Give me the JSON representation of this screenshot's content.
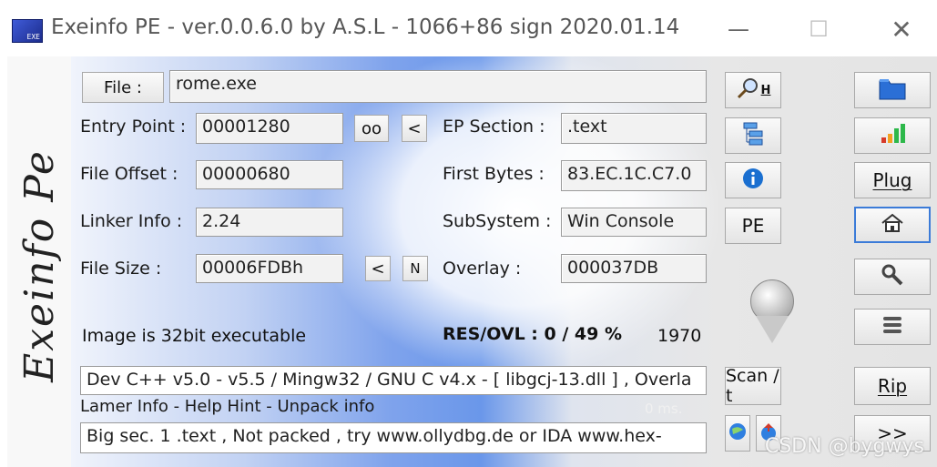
{
  "window": {
    "title": "Exeinfo PE - ver.0.0.6.0  by A.S.L -  1066+86 sign  2020.01.14",
    "app_icon_text": "EXE",
    "minimize": "—",
    "maximize": "☐",
    "close": "✕"
  },
  "brand": "Exeinfo Pe",
  "file": {
    "button_label": "File :",
    "value": "rome.exe"
  },
  "fields": {
    "entry_point_label": "Entry Point :",
    "entry_point_value": "00001280",
    "oo_button": "oo",
    "lt_button": "<",
    "ep_section_label": "EP Section :",
    "ep_section_value": ".text",
    "file_offset_label": "File Offset :",
    "file_offset_value": "00000680",
    "first_bytes_label": "First Bytes :",
    "first_bytes_value": "83.EC.1C.C7.0",
    "linker_info_label": "Linker Info :",
    "linker_info_value": "2.24",
    "subsystem_label": "SubSystem :",
    "subsystem_value": "Win Console",
    "file_size_label": "File Size :",
    "file_size_value": "00006FDBh",
    "size_lt_button": "<",
    "size_n_button": "N",
    "overlay_label": "Overlay :",
    "overlay_value": "000037DB"
  },
  "status": {
    "image_bits": "Image is 32bit executable",
    "res_ovl": "RES/OVL : 0 / 49 %",
    "year": "1970",
    "detect": "Dev C++ v5.0 - v5.5 / Mingw32 / GNU C v4.x - [ libgcj-13.dll ] , Overla",
    "lamer_info": "Lamer Info - Help Hint - Unpack info",
    "ms": "0 ms.",
    "hint": "Big sec. 1 .text  , Not packed , try  www.ollydbg.de or IDA  www.hex-"
  },
  "mid_buttons": {
    "search_h": "H",
    "pe": "PE",
    "scan": "Scan / t"
  },
  "right_buttons": {
    "plug": "Plug",
    "rip": "Rip",
    "more": ">>"
  },
  "watermark": "CSDN @bygwys",
  "colors": {
    "accent_blue": "#6a97ea",
    "folder_blue": "#2b6fd6",
    "info_blue": "#1a6fd0",
    "bar_green": "#2db84a",
    "bar_orange": "#f3a020",
    "bar_red": "#d63a2a"
  }
}
